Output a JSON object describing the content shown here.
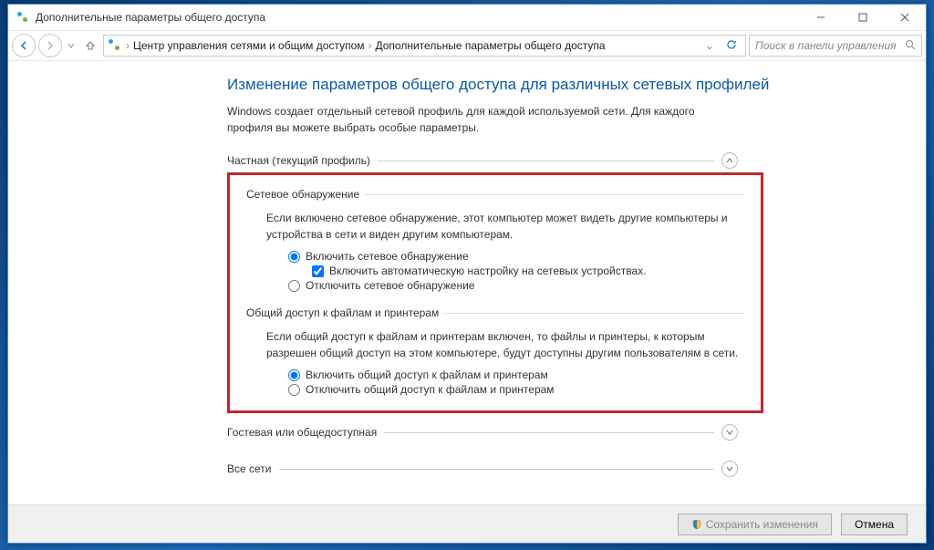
{
  "titlebar": {
    "title": "Дополнительные параметры общего доступа"
  },
  "breadcrumb": {
    "item1": "Центр управления сетями и общим доступом",
    "item2": "Дополнительные параметры общего доступа"
  },
  "search": {
    "placeholder": "Поиск в панели управления"
  },
  "page": {
    "title": "Изменение параметров общего доступа для различных сетевых профилей",
    "desc": "Windows создает отдельный сетевой профиль для каждой используемой сети. Для каждого профиля вы можете выбрать особые параметры."
  },
  "sections": {
    "private": "Частная (текущий профиль)",
    "guest": "Гостевая или общедоступная",
    "all": "Все сети"
  },
  "groups": {
    "discovery": {
      "title": "Сетевое обнаружение",
      "desc": "Если включено сетевое обнаружение, этот компьютер может видеть другие компьютеры и устройства в сети и виден другим компьютерам.",
      "opt_on": "Включить сетевое обнаружение",
      "opt_auto": "Включить автоматическую настройку на сетевых устройствах.",
      "opt_off": "Отключить сетевое обнаружение"
    },
    "fileshare": {
      "title": "Общий доступ к файлам и принтерам",
      "desc": "Если общий доступ к файлам и принтерам включен, то файлы и принтеры, к которым разрешен общий доступ на этом компьютере, будут доступны другим пользователям в сети.",
      "opt_on": "Включить общий доступ к файлам и принтерам",
      "opt_off": "Отключить общий доступ к файлам и принтерам"
    }
  },
  "footer": {
    "save": "Сохранить изменения",
    "cancel": "Отмена"
  }
}
